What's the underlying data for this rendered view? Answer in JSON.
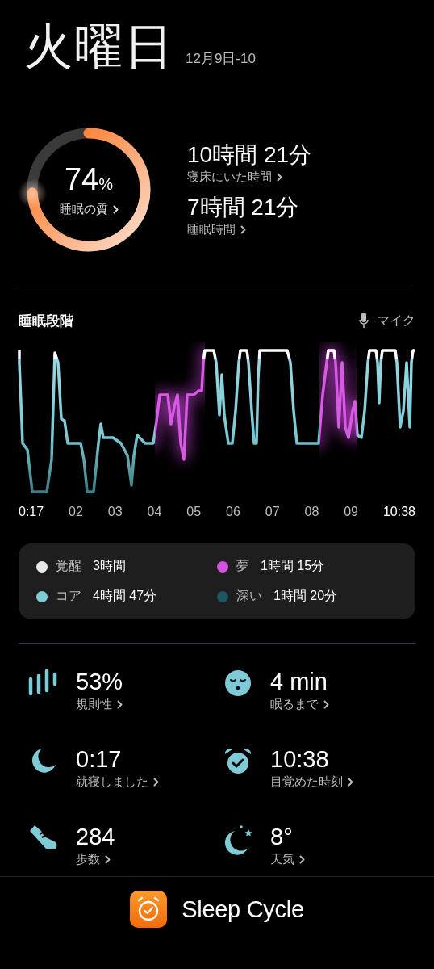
{
  "header": {
    "day": "火曜日",
    "date": "12月9日-10"
  },
  "summary": {
    "quality": {
      "value": "74",
      "unit": "%",
      "label": "睡眠の質",
      "level": 0.74
    },
    "stats": [
      {
        "value": "10時間 21分",
        "label": "寝床にいた時間"
      },
      {
        "value": "7時間 21分",
        "label": "睡眠時間"
      }
    ]
  },
  "stages": {
    "title": "睡眠段階",
    "mic": "マイク",
    "x_labels": [
      "0:17",
      "02",
      "03",
      "04",
      "05",
      "06",
      "07",
      "08",
      "09",
      "10:38"
    ],
    "legend": [
      {
        "name": "覚醒",
        "duration": "3時間",
        "color": "#e8e8e8"
      },
      {
        "name": "夢",
        "duration": "1時間 15分",
        "color": "#d452e0"
      },
      {
        "name": "コア",
        "duration": "4時間 47分",
        "color": "#7ccbd6"
      },
      {
        "name": "深い",
        "duration": "1時間 20分",
        "color": "#1f5560"
      }
    ]
  },
  "metrics": [
    {
      "kind": "regularity",
      "value": "53%",
      "label": "規則性"
    },
    {
      "kind": "latency",
      "value": "4 min",
      "label": "眠るまで"
    },
    {
      "kind": "bedtime",
      "value": "0:17",
      "label": "就寝しました"
    },
    {
      "kind": "wakeup",
      "value": "10:38",
      "label": "目覚めた時刻"
    },
    {
      "kind": "steps",
      "value": "284",
      "label": "歩数"
    },
    {
      "kind": "weather",
      "value": "8°",
      "label": "天気"
    }
  ],
  "footer": {
    "app_name": "Sleep Cycle"
  }
}
